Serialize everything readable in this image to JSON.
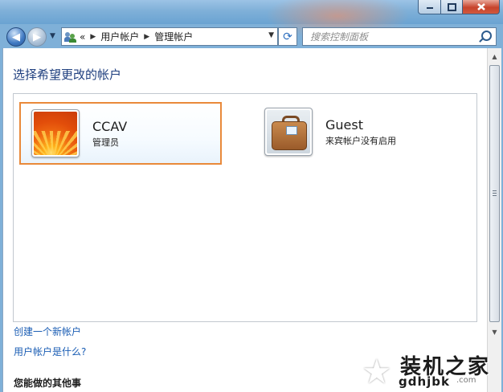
{
  "window": {
    "min_icon": "minimize-icon",
    "max_icon": "maximize-icon",
    "close_icon": "close-icon"
  },
  "nav": {
    "back_icon": "back-arrow-icon",
    "forward_icon": "forward-arrow-icon",
    "breadcrumb_overflow": "«",
    "breadcrumb": [
      "用户帐户",
      "管理帐户"
    ],
    "refresh_icon": "refresh-icon",
    "search_placeholder": "搜索控制面板",
    "search_icon": "search-icon"
  },
  "main": {
    "heading": "选择希望更改的帐户",
    "accounts": [
      {
        "name": "CCAV",
        "subtitle": "管理员",
        "picture": "flower-picture",
        "selected": true
      },
      {
        "name": "Guest",
        "subtitle": "来宾帐户没有启用",
        "picture": "luggage-picture",
        "selected": false
      }
    ],
    "links": [
      "创建一个新帐户",
      "用户帐户是什么?"
    ],
    "section_heading": "您能做的其他事"
  },
  "watermark": {
    "cn": "装机之家",
    "en": "gdhjbk",
    "suffix": ".com"
  },
  "colors": {
    "accent": "#1f3f7f",
    "link": "#1a5db4",
    "selection_border": "#e9893a"
  }
}
